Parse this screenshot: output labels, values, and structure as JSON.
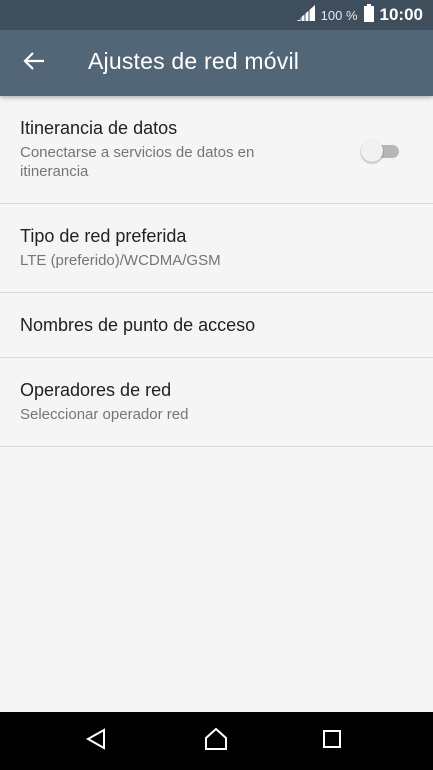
{
  "status_bar": {
    "battery_text": "100 %",
    "clock": "10:00"
  },
  "app_bar": {
    "title": "Ajustes de red móvil"
  },
  "settings": [
    {
      "title": "Itinerancia de datos",
      "subtitle": "Conectarse a servicios de datos en itinerancia",
      "toggle_on": false
    },
    {
      "title": "Tipo de red preferida",
      "subtitle": "LTE (preferido)/WCDMA/GSM"
    },
    {
      "title": "Nombres de punto de acceso"
    },
    {
      "title": "Operadores de red",
      "subtitle": "Seleccionar operador red"
    }
  ],
  "colors": {
    "status_bar": "#3e4e5c",
    "app_bar": "#526677",
    "background": "#f5f5f5",
    "nav_bar": "#000000"
  },
  "icons": {
    "back": "arrow-left-icon",
    "signal": "signal-icon",
    "battery": "battery-icon",
    "nav_back": "triangle-back-icon",
    "nav_home": "home-icon",
    "nav_recents": "square-recents-icon"
  }
}
